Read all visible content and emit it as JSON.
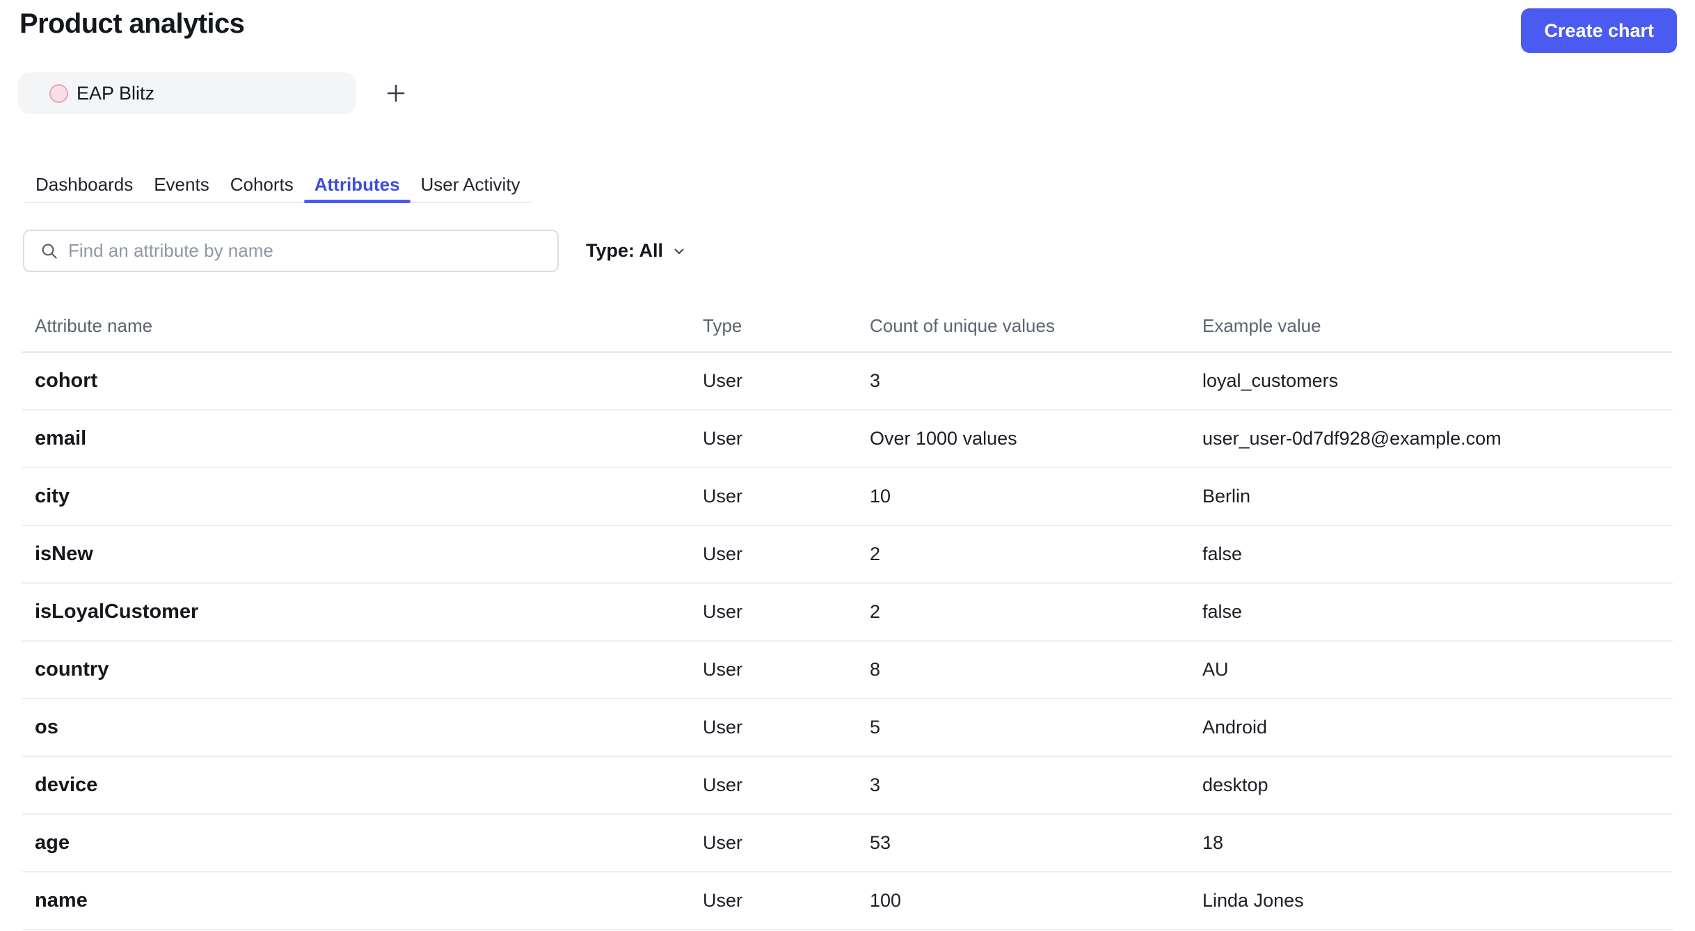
{
  "header": {
    "title": "Product analytics",
    "create_chart_label": "Create chart"
  },
  "project_chip": {
    "label": "EAP Blitz"
  },
  "tabs": [
    {
      "label": "Dashboards",
      "active": false
    },
    {
      "label": "Events",
      "active": false
    },
    {
      "label": "Cohorts",
      "active": false
    },
    {
      "label": "Attributes",
      "active": true
    },
    {
      "label": "User Activity",
      "active": false
    }
  ],
  "filters": {
    "search_placeholder": "Find an attribute by name",
    "search_value": "",
    "type_filter_label": "Type: All"
  },
  "table": {
    "columns": [
      "Attribute name",
      "Type",
      "Count of unique values",
      "Example value"
    ],
    "rows": [
      {
        "name": "cohort",
        "type": "User",
        "count": "3",
        "example": "loyal_customers"
      },
      {
        "name": "email",
        "type": "User",
        "count": "Over 1000 values",
        "example": "user_user-0d7df928@example.com"
      },
      {
        "name": "city",
        "type": "User",
        "count": "10",
        "example": "Berlin"
      },
      {
        "name": "isNew",
        "type": "User",
        "count": "2",
        "example": "false"
      },
      {
        "name": "isLoyalCustomer",
        "type": "User",
        "count": "2",
        "example": "false"
      },
      {
        "name": "country",
        "type": "User",
        "count": "8",
        "example": "AU"
      },
      {
        "name": "os",
        "type": "User",
        "count": "5",
        "example": "Android"
      },
      {
        "name": "device",
        "type": "User",
        "count": "3",
        "example": "desktop"
      },
      {
        "name": "age",
        "type": "User",
        "count": "53",
        "example": "18"
      },
      {
        "name": "name",
        "type": "User",
        "count": "100",
        "example": "Linda Jones"
      }
    ]
  },
  "icons": {
    "search": "magnifier",
    "chevron_down": "chevron-down",
    "plus": "plus"
  },
  "colors": {
    "accent_button": "#4B5BF2",
    "tab_active": "#3D4DE1",
    "chip_dot_fill": "#F8DEE5",
    "chip_dot_border": "#E2A9B8"
  }
}
